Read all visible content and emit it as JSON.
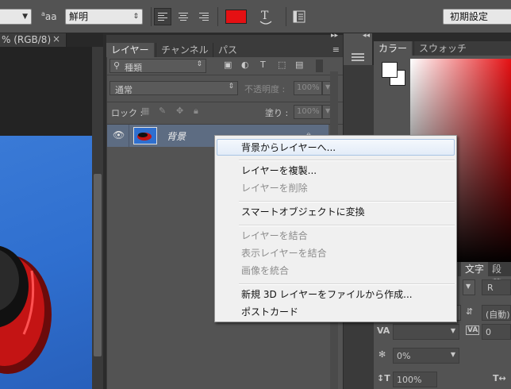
{
  "options_bar": {
    "size_label": "aa",
    "size_superscript": "a",
    "antialias_value": "鮮明",
    "workspace_value": "初期設定"
  },
  "document_tab": {
    "title": "% (RGB/8)",
    "close_glyph": "×"
  },
  "layers_panel": {
    "tabs": [
      "レイヤー",
      "チャンネル",
      "パス"
    ],
    "filter_label": "種類",
    "blend_mode": "通常",
    "opacity_label": "不透明度 :",
    "opacity_value": "100%",
    "lock_label": "ロック :",
    "fill_label": "塗り :",
    "fill_value": "100%",
    "layer_name": "背景"
  },
  "color_panel": {
    "tabs": [
      "カラー",
      "スウォッチ"
    ],
    "accent_color": "#e51013"
  },
  "character_panel": {
    "tabs": [
      "文字",
      "段落"
    ],
    "font_style": "R",
    "leading_value": "(自動)",
    "tracking_value": "0",
    "baseline_value": "0%",
    "scale_value": "100%"
  },
  "context_menu": {
    "items": [
      {
        "label": "背景からレイヤーへ...",
        "enabled": true
      },
      {
        "label": "レイヤーを複製...",
        "enabled": true
      },
      {
        "label": "レイヤーを削除",
        "enabled": false
      },
      {
        "label": "スマートオブジェクトに変換",
        "enabled": true
      },
      {
        "label": "レイヤーを結合",
        "enabled": false
      },
      {
        "label": "表示レイヤーを結合",
        "enabled": false
      },
      {
        "label": "画像を統合",
        "enabled": false
      },
      {
        "label": "新規 3D レイヤーをファイルから作成...",
        "enabled": true
      },
      {
        "label": "ポストカード",
        "enabled": true
      }
    ]
  }
}
